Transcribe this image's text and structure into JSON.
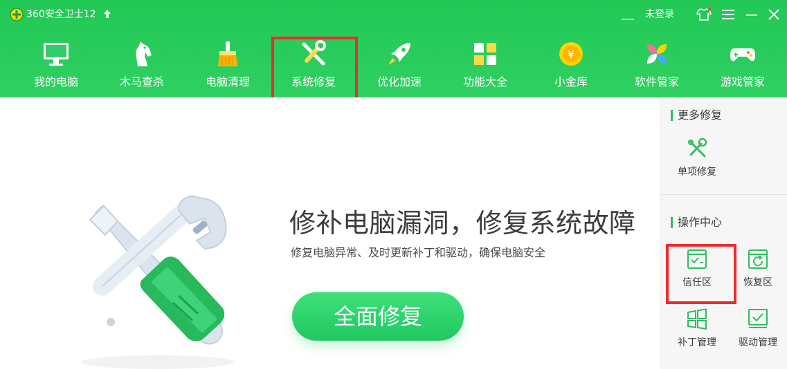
{
  "app": {
    "title": "360安全卫士12",
    "login": "未登录"
  },
  "colors": {
    "brand_green": "#2ed05f",
    "highlight_red": "#ef2b2b"
  },
  "nav": [
    {
      "label": "我的电脑",
      "icon": "monitor-icon"
    },
    {
      "label": "木马查杀",
      "icon": "horse-icon"
    },
    {
      "label": "电脑清理",
      "icon": "broom-icon"
    },
    {
      "label": "系统修复",
      "icon": "wrench-screwdriver-icon",
      "active": true
    },
    {
      "label": "优化加速",
      "icon": "rocket-icon"
    },
    {
      "label": "功能大全",
      "icon": "grid-icon"
    },
    {
      "label": "小金库",
      "icon": "coin-icon"
    },
    {
      "label": "软件管家",
      "icon": "flower-icon"
    },
    {
      "label": "游戏管家",
      "icon": "gamepad-icon"
    }
  ],
  "hero": {
    "title": "修补电脑漏洞，修复系统故障",
    "subtitle": "修复电脑异常、及时更新补丁和驱动，确保电脑安全",
    "button": "全面修复"
  },
  "side": {
    "more_title": "更多修复",
    "single": "单项修复",
    "ops_title": "操作中心",
    "tools": [
      {
        "label": "信任区",
        "icon": "trust-zone-icon"
      },
      {
        "label": "恢复区",
        "icon": "restore-zone-icon"
      },
      {
        "label": "补丁管理",
        "icon": "windows-patch-icon"
      },
      {
        "label": "驱动管理",
        "icon": "driver-icon"
      }
    ]
  }
}
